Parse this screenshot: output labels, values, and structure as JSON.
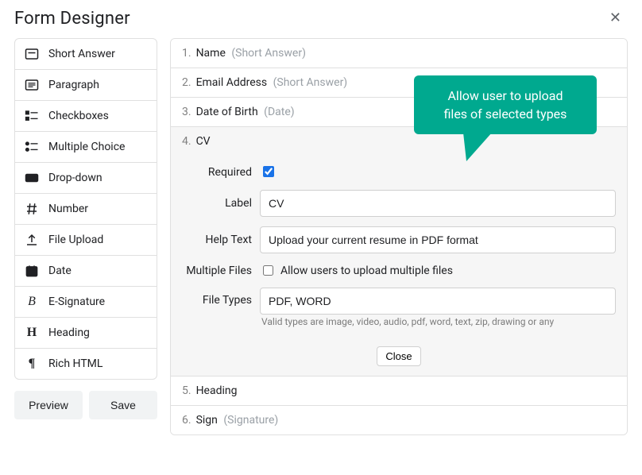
{
  "header": {
    "title": "Form Designer"
  },
  "sidebar": {
    "types": [
      {
        "label": "Short Answer"
      },
      {
        "label": "Paragraph"
      },
      {
        "label": "Checkboxes"
      },
      {
        "label": "Multiple Choice"
      },
      {
        "label": "Drop-down"
      },
      {
        "label": "Number"
      },
      {
        "label": "File Upload"
      },
      {
        "label": "Date"
      },
      {
        "label": "E-Signature"
      },
      {
        "label": "Heading"
      },
      {
        "label": "Rich HTML"
      }
    ],
    "preview": "Preview",
    "save": "Save"
  },
  "fields": {
    "f1": {
      "num": "1.",
      "name": "Name",
      "type": "(Short Answer)"
    },
    "f2": {
      "num": "2.",
      "name": "Email Address",
      "type": "(Short Answer)"
    },
    "f3": {
      "num": "3.",
      "name": "Date of Birth",
      "type": "(Date)"
    },
    "f4": {
      "num": "4.",
      "name": "CV"
    },
    "f5": {
      "num": "5.",
      "name": "Heading",
      "type": ""
    },
    "f6": {
      "num": "6.",
      "name": "Sign",
      "type": "(Signature)"
    }
  },
  "editor": {
    "required_label": "Required",
    "label_label": "Label",
    "label_value": "CV",
    "help_label": "Help Text",
    "help_value": "Upload your current resume in PDF format",
    "multi_label": "Multiple Files",
    "multi_option": "Allow users to upload multiple files",
    "types_label": "File Types",
    "types_value": "PDF, WORD",
    "types_hint": "Valid types are image, video, audio, pdf, word, text, zip, drawing or any",
    "close": "Close"
  },
  "tooltip": {
    "line1": "Allow user to upload",
    "line2": "files of selected types"
  }
}
